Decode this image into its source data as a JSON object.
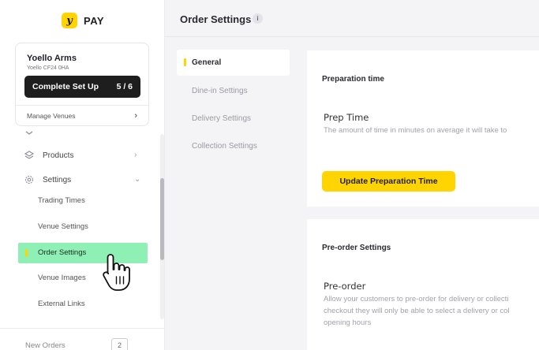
{
  "brand": {
    "logo_glyph": "y",
    "name": "PAY",
    "accent": "#ffd400"
  },
  "venue": {
    "name": "Yoello Arms",
    "address": "Yoello CF24 0HA",
    "setup_label": "Complete Set Up",
    "setup_progress": "5 / 6",
    "manage_label": "Manage Venues"
  },
  "nav": {
    "products": "Products",
    "settings": "Settings",
    "sub_items": {
      "trading_times": "Trading Times",
      "venue_settings": "Venue Settings",
      "order_settings": "Order Settings",
      "venue_images": "Venue Images",
      "external_links": "External Links"
    }
  },
  "footer": {
    "new_orders_label": "New Orders",
    "new_orders_count": "2"
  },
  "page": {
    "title": "Order Settings",
    "info_glyph": "i"
  },
  "tabs": [
    "General",
    "Dine-in Settings",
    "Delivery Settings",
    "Collection Settings"
  ],
  "prep_card": {
    "title": "Preparation time",
    "field_label": "Prep Time",
    "field_desc": "The amount of time in minutes on average it will take to",
    "button_label": "Update Preparation Time"
  },
  "preorder_card": {
    "title": "Pre-order Settings",
    "field_label": "Pre-order",
    "desc_lines": [
      "Allow your customers to pre-order for delivery or collecti",
      "checkout they will only be able to select a delivery or col",
      "opening hours"
    ]
  },
  "colors": {
    "active_nav": "#8ef0b4",
    "button": "#ffd400",
    "dark_button": "#1e1e1e"
  }
}
